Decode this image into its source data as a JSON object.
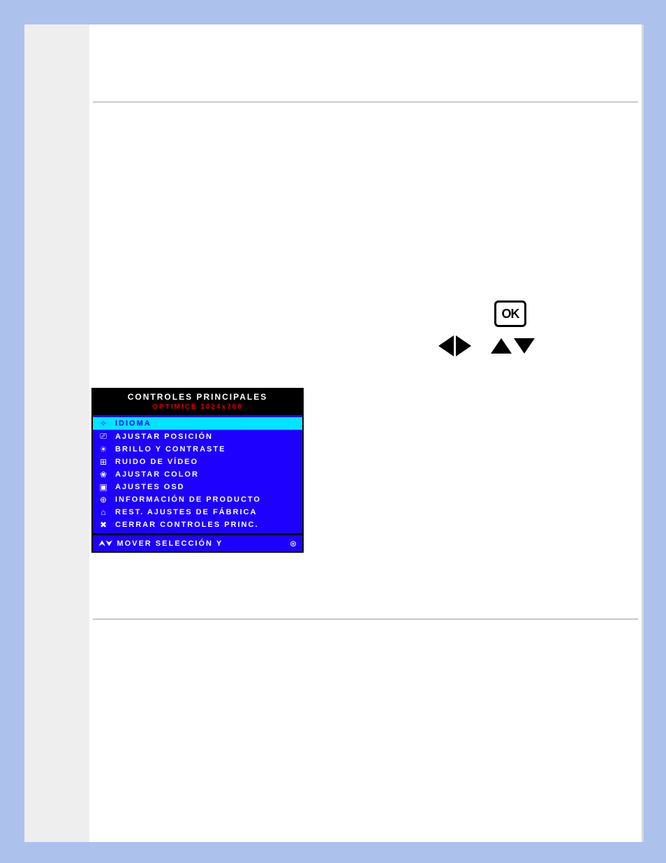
{
  "controls": {
    "ok_label": "OK"
  },
  "osd": {
    "title": "CONTROLES PRINCIPALES",
    "subtitle": "OPTIMICE 1024x768",
    "items": [
      {
        "icon": "✧",
        "label": "IDIOMA",
        "selected": true,
        "name": "osd-item-idioma"
      },
      {
        "icon": "⎚",
        "label": "AJUSTAR POSICIÓN",
        "selected": false,
        "name": "osd-item-ajustar-posicion"
      },
      {
        "icon": "☀",
        "label": "BRILLO Y CONTRASTE",
        "selected": false,
        "name": "osd-item-brillo-contraste"
      },
      {
        "icon": "⊞",
        "label": "RUIDO DE VÍDEO",
        "selected": false,
        "name": "osd-item-ruido-video"
      },
      {
        "icon": "❀",
        "label": "AJUSTAR COLOR",
        "selected": false,
        "name": "osd-item-ajustar-color"
      },
      {
        "icon": "▣",
        "label": "AJUSTES OSD",
        "selected": false,
        "name": "osd-item-ajustes-osd"
      },
      {
        "icon": "⊕",
        "label": "INFORMACIÓN DE PRODUCTO",
        "selected": false,
        "name": "osd-item-informacion-producto"
      },
      {
        "icon": "⌂",
        "label": "REST. AJUSTES DE FÁBRICA",
        "selected": false,
        "name": "osd-item-restaurar-fabrica"
      },
      {
        "icon": "✖",
        "label": "CERRAR CONTROLES PRINC.",
        "selected": false,
        "name": "osd-item-cerrar"
      }
    ],
    "footer": {
      "left_icon": "⮝⮟",
      "text": "MOVER SELECCIÓN Y",
      "right_icon": "⊛"
    }
  }
}
